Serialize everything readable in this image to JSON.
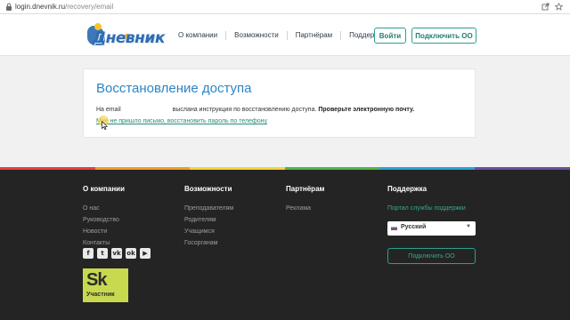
{
  "browser": {
    "url_host": "login.dnevnik.ru",
    "url_path": "/recovery/email"
  },
  "header": {
    "logo_text": "Дневник",
    "nav": [
      {
        "label": "О компании"
      },
      {
        "label": "Возможности"
      },
      {
        "label": "Партнёрам"
      },
      {
        "label": "Поддержка"
      }
    ],
    "login_label": "Войти",
    "connect_label": "Подключить ОО"
  },
  "recovery": {
    "title": "Восстановление доступа",
    "msg_prefix": "На email",
    "msg_main": "выслана инструкция по восстановлению доступа.",
    "msg_bold": "Проверьте электронную почту.",
    "phone_link": "Мне не пришло письмо, восстановить пароль по телефону"
  },
  "footer": {
    "columns": [
      {
        "heading": "О компании",
        "links": [
          "О нас",
          "Руководство",
          "Новости",
          "Контакты"
        ]
      },
      {
        "heading": "Возможности",
        "links": [
          "Преподавателям",
          "Родителям",
          "Учащимся",
          "Госорганам"
        ]
      },
      {
        "heading": "Партнёрам",
        "links": [
          "Реклама"
        ]
      },
      {
        "heading": "Поддержка",
        "links": [
          "Портал службы поддержки"
        ]
      }
    ],
    "socials": [
      {
        "icon": "facebook-icon",
        "glyph": "f"
      },
      {
        "icon": "twitter-icon",
        "glyph": "t"
      },
      {
        "icon": "vk-icon",
        "glyph": "vk"
      },
      {
        "icon": "odnoklassniki-icon",
        "glyph": "ok"
      },
      {
        "icon": "youtube-icon",
        "glyph": "▶"
      }
    ],
    "skolkovo_mark": "Sk",
    "skolkovo_label": "Участник",
    "language": "Русский",
    "connect_label": "Подключить ОО",
    "stripe_colors": [
      "#e7403a",
      "#f39b2c",
      "#f6d33a",
      "#4fb649",
      "#2a9fd8",
      "#6b4ea0"
    ]
  },
  "colors": {
    "accent": "#2aa18e",
    "title_blue": "#2b86c5",
    "footer_bg": "#242424"
  }
}
